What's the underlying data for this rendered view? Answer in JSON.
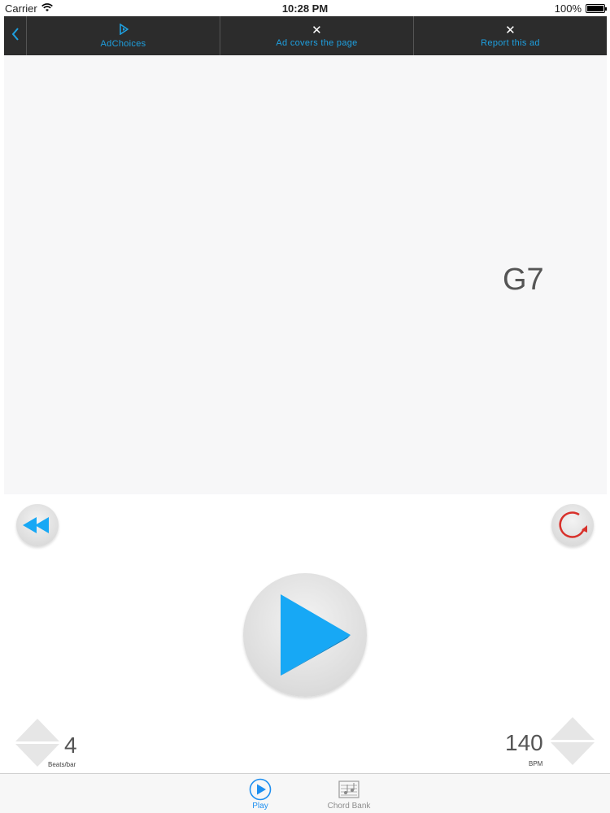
{
  "status_bar": {
    "carrier": "Carrier",
    "time": "10:28 PM",
    "battery": "100%"
  },
  "ad_bar": {
    "back_icon": "chevron-left-icon",
    "items": [
      {
        "label": "AdChoices",
        "icon": "adchoices-icon"
      },
      {
        "label": "Ad covers the page",
        "icon": "close-icon"
      },
      {
        "label": "Report this ad",
        "icon": "close-icon"
      }
    ]
  },
  "chord": {
    "current": "G7"
  },
  "controls": {
    "rewind_icon": "rewind-icon",
    "repeat_icon": "repeat-icon",
    "play_icon": "play-icon",
    "beats": {
      "value": "4",
      "label": "Beats/bar"
    },
    "bpm": {
      "value": "140",
      "label": "BPM"
    }
  },
  "tab_bar": {
    "tabs": [
      {
        "label": "Play",
        "icon": "play-circle-icon",
        "selected": true
      },
      {
        "label": "Chord Bank",
        "icon": "music-sheet-icon",
        "selected": false
      }
    ]
  },
  "colors": {
    "accent": "#1e8ff0",
    "play_blue": "#17a8f5",
    "ad_bar_bg": "#2c2c2c",
    "ad_text": "#1ea0e0",
    "repeat_red": "#d8312b"
  }
}
